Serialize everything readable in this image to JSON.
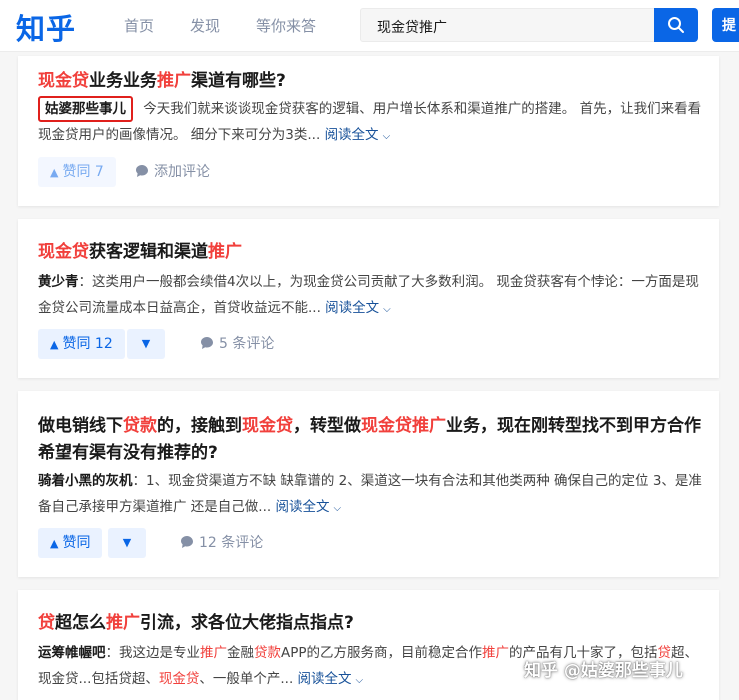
{
  "header": {
    "logo": "知乎",
    "nav": [
      "首页",
      "发现",
      "等你来答"
    ],
    "search_value": "现金贷推广",
    "ask_label": "提",
    "accent": "#0a66e6"
  },
  "results": [
    {
      "title": [
        {
          "text": "现金贷",
          "hl": true
        },
        {
          "text": "业务业务",
          "hl": false
        },
        {
          "text": "推广",
          "hl": true
        },
        {
          "text": "渠道有哪些?",
          "hl": false
        }
      ],
      "author": "姑婆那些事儿",
      "excerpt": "今天我们就来谈谈现金贷获客的逻辑、用户增长体系和渠道推广的搭建。 首先，让我们来看看现金贷用户的画像情况。 细分下来可分为3类...",
      "read_more": "阅读全文",
      "upvote_label": "赞同 7",
      "comment_label": "添加评论"
    },
    {
      "title": [
        {
          "text": "现金贷",
          "hl": true
        },
        {
          "text": "获客逻辑和渠道",
          "hl": false
        },
        {
          "text": "推广",
          "hl": true
        }
      ],
      "author": "黄少青",
      "excerpt": "这类用户一般都会续借4次以上，为现金贷公司贡献了大多数利润。 现金贷获客有个悖论：一方面是现金贷公司流量成本日益高企，首贷收益远不能...",
      "read_more": "阅读全文",
      "upvote_label": "赞同 12",
      "comment_label": "5 条评论"
    },
    {
      "title": [
        {
          "text": "做电销线下",
          "hl": false
        },
        {
          "text": "贷款",
          "hl": true
        },
        {
          "text": "的，接触到",
          "hl": false
        },
        {
          "text": "现金贷",
          "hl": true
        },
        {
          "text": "，转型做",
          "hl": false
        },
        {
          "text": "现金贷推广",
          "hl": true
        },
        {
          "text": "业务，现在刚转型找不到甲方合作希望有渠有没有推荐的?",
          "hl": false
        }
      ],
      "author": "骑着小黑的灰机",
      "excerpt": "1、现金贷渠道方不缺 缺靠谱的 2、渠道这一块有合法和其他类两种 确保自己的定位 3、是准备自己承接甲方渠道推广 还是自己做...",
      "read_more": "阅读全文",
      "upvote_label": "赞同",
      "comment_label": "12 条评论"
    },
    {
      "title": [
        {
          "text": "贷",
          "hl": true
        },
        {
          "text": "超怎么",
          "hl": false
        },
        {
          "text": "推广",
          "hl": true
        },
        {
          "text": "引流，求各位大佬指点指点?",
          "hl": false
        }
      ],
      "author": "运筹帷幄吧",
      "excerpt_parts": [
        {
          "text": "我这边是专业",
          "hl": false
        },
        {
          "text": "推广",
          "hl": true
        },
        {
          "text": "金融",
          "hl": false
        },
        {
          "text": "贷款",
          "hl": true
        },
        {
          "text": "APP的乙方服务商，目前稳定合作",
          "hl": false
        },
        {
          "text": "推广",
          "hl": true
        },
        {
          "text": "的产品有几十家了，包括",
          "hl": false
        },
        {
          "text": "贷",
          "hl": true
        },
        {
          "text": "超、现金贷...包括贷超、",
          "hl": false
        },
        {
          "text": "现金贷",
          "hl": true
        },
        {
          "text": "、一般单个产...",
          "hl": false
        }
      ],
      "read_more": "阅读全文"
    }
  ],
  "watermark": "知乎 @姑婆那些事儿",
  "highlight_color": "#f1403c"
}
